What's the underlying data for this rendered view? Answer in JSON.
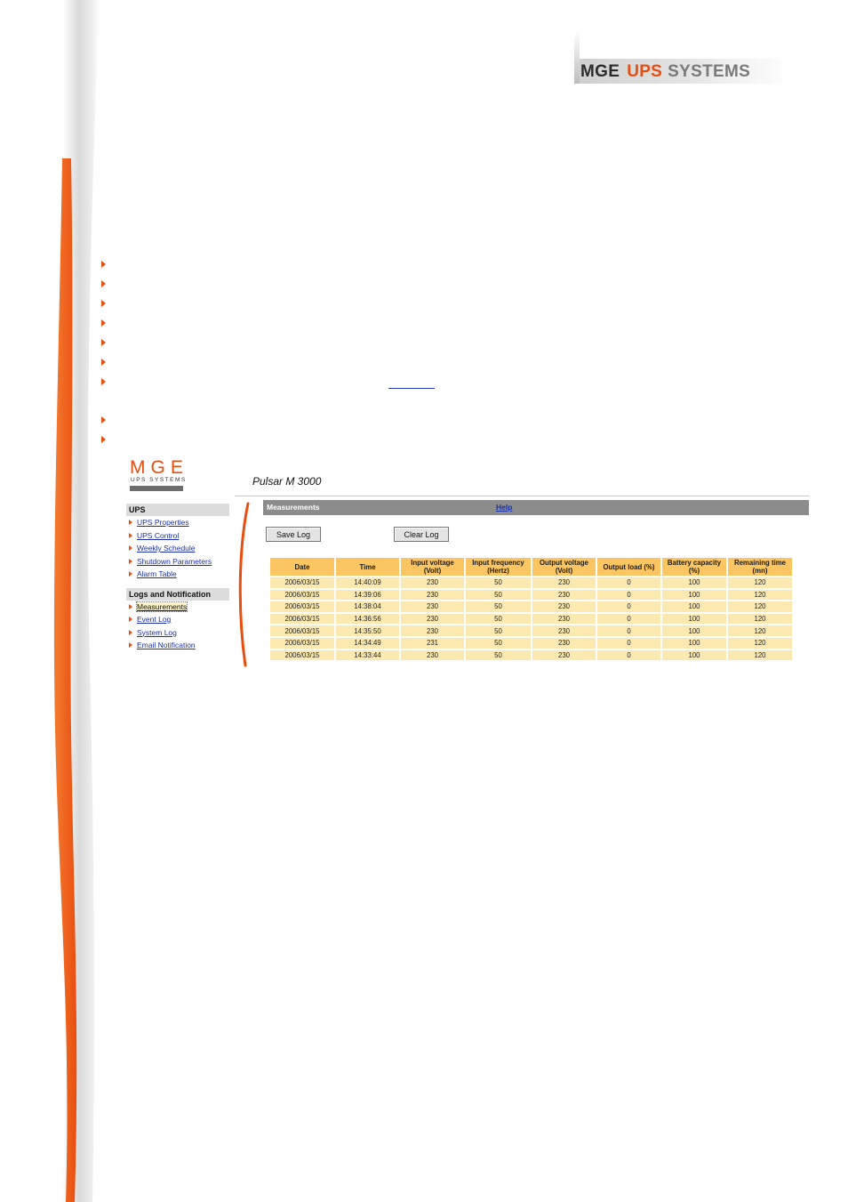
{
  "header_logo": {
    "mge": "MGE",
    "ups": "UPS",
    "systems": "SYSTEMS"
  },
  "ui": {
    "logo": {
      "letters": "MGE",
      "subtitle": "UPS SYSTEMS"
    },
    "device_title": "Pulsar M 3000",
    "sidebar": {
      "sections": [
        {
          "title": "UPS",
          "items": [
            {
              "label": "UPS Properties"
            },
            {
              "label": "UPS Control"
            },
            {
              "label": "Weekly Schedule"
            },
            {
              "label": "Shutdown Parameters"
            },
            {
              "label": "Alarm Table"
            }
          ]
        },
        {
          "title": "Logs and Notification",
          "items": [
            {
              "label": "Measurements",
              "active": true
            },
            {
              "label": "Event Log"
            },
            {
              "label": "System Log"
            },
            {
              "label": "Email Notification"
            }
          ]
        }
      ]
    },
    "main": {
      "title": "Measurements",
      "help": "Help",
      "buttons": {
        "save": "Save Log",
        "clear": "Clear Log"
      },
      "table": {
        "columns": [
          "Date",
          "Time",
          "Input voltage\n(Volt)",
          "Input frequency\n(Hertz)",
          "Output voltage\n(Volt)",
          "Output load (%)",
          "Battery capacity\n(%)",
          "Remaining time\n(mn)"
        ],
        "rows": [
          [
            "2006/03/15",
            "14:40:09",
            "230",
            "50",
            "230",
            "0",
            "100",
            "120"
          ],
          [
            "2006/03/15",
            "14:39:06",
            "230",
            "50",
            "230",
            "0",
            "100",
            "120"
          ],
          [
            "2006/03/15",
            "14:38:04",
            "230",
            "50",
            "230",
            "0",
            "100",
            "120"
          ],
          [
            "2006/03/15",
            "14:36:56",
            "230",
            "50",
            "230",
            "0",
            "100",
            "120"
          ],
          [
            "2006/03/15",
            "14:35:50",
            "230",
            "50",
            "230",
            "0",
            "100",
            "120"
          ],
          [
            "2006/03/15",
            "14:34:49",
            "231",
            "50",
            "230",
            "0",
            "100",
            "120"
          ],
          [
            "2006/03/15",
            "14:33:44",
            "230",
            "50",
            "230",
            "0",
            "100",
            "120"
          ]
        ]
      }
    }
  },
  "colors": {
    "accent": "#e84e0f",
    "table_header": "#fbc662",
    "table_cell": "#fbe9b0",
    "title_bar": "#8c8c8c",
    "link": "#1a2fa8"
  }
}
